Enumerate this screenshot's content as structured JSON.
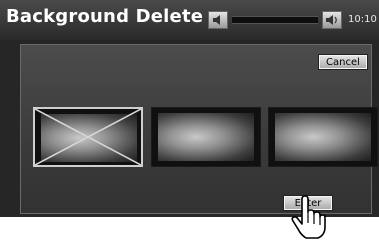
{
  "header": {
    "title": "Background Delete",
    "clock": "10:10",
    "volume": {
      "down_icon": "speaker-down-icon",
      "up_icon": "speaker-up-icon"
    }
  },
  "actions": {
    "cancel_label": "Cancel",
    "enter_label": "Enter"
  },
  "backgrounds": [
    {
      "state": "selected-for-delete"
    },
    {
      "state": "normal"
    },
    {
      "state": "normal"
    }
  ],
  "pointer": {
    "icon": "hand-pointer-icon"
  }
}
